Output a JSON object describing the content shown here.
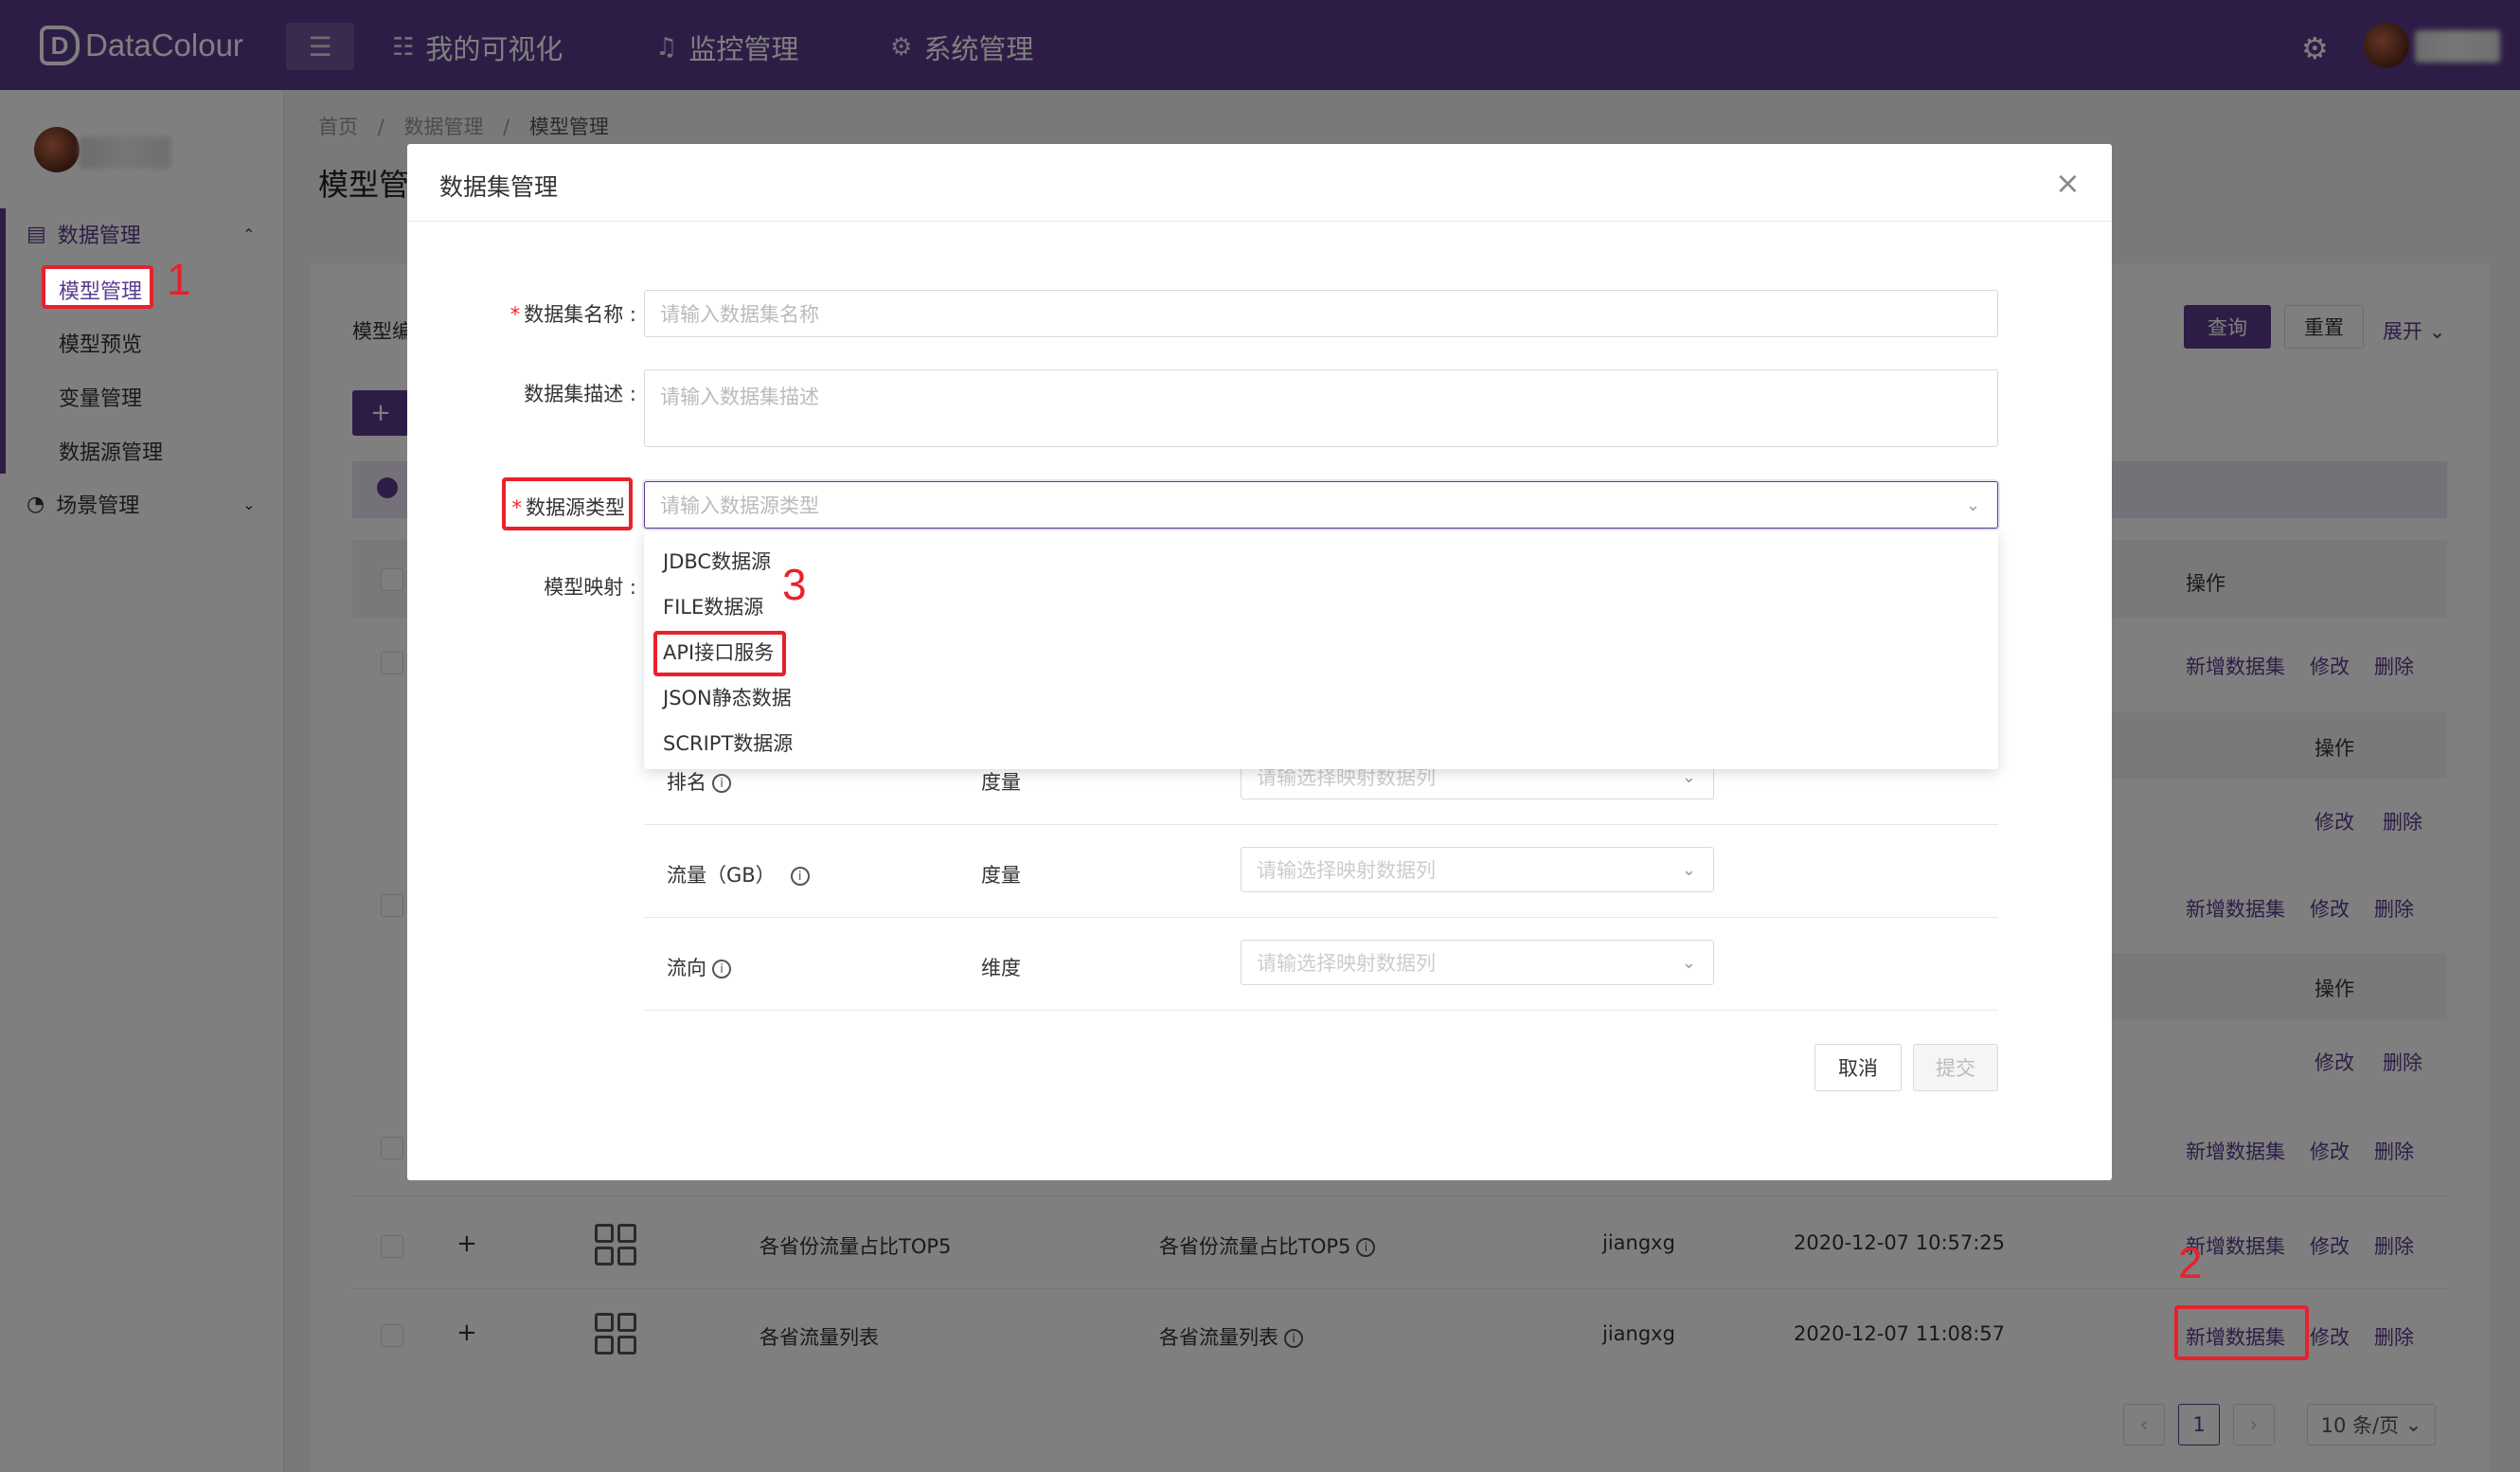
{
  "app": {
    "logo_text": "DataColour"
  },
  "topnav": {
    "items": [
      {
        "label": "我的可视化"
      },
      {
        "label": "监控管理"
      },
      {
        "label": "系统管理"
      }
    ]
  },
  "sidebar": {
    "groups": [
      {
        "label": "数据管理",
        "items": [
          {
            "label": "模型管理"
          },
          {
            "label": "模型预览"
          },
          {
            "label": "变量管理"
          },
          {
            "label": "数据源管理"
          }
        ]
      },
      {
        "label": "场景管理"
      }
    ]
  },
  "breadcrumb": {
    "items": [
      "首页",
      "数据管理",
      "模型管理"
    ],
    "separator": "/"
  },
  "page": {
    "title": "模型管"
  },
  "filter": {
    "label": "模型编",
    "search_label": "查询",
    "reset_label": "重置",
    "expand_label": "展开"
  },
  "table": {
    "header_op": "操作",
    "sub_header_op": "操作",
    "ops": {
      "add_dataset": "新增数据集",
      "edit": "修改",
      "delete": "删除"
    },
    "rows": [
      {
        "name": "各省份流量占比TOP5",
        "alias": "各省份流量占比TOP5",
        "owner": "jiangxg",
        "time": "2020-12-07 10:57:25"
      },
      {
        "name": "各省流量列表",
        "alias": "各省流量列表",
        "owner": "jiangxg",
        "time": "2020-12-07 11:08:57"
      }
    ]
  },
  "pagination": {
    "current": "1",
    "page_size": "10 条/页"
  },
  "dialog": {
    "title": "数据集管理",
    "fields": {
      "name": {
        "label": "数据集名称 :",
        "placeholder": "请输入数据集名称"
      },
      "desc": {
        "label": "数据集描述 :",
        "placeholder": "请输入数据集描述"
      },
      "source_type": {
        "label": "数据源类型",
        "placeholder": "请输入数据源类型"
      },
      "mapping": {
        "label": "模型映射 :"
      }
    },
    "dropdown_options": [
      "JDBC数据源",
      "FILE数据源",
      "API接口服务",
      "JSON静态数据",
      "SCRIPT数据源"
    ],
    "mapping_rows": [
      {
        "field": "排名",
        "type": "度量",
        "placeholder": "请输选择映射数据列"
      },
      {
        "field": "流量（GB）",
        "type": "度量",
        "placeholder": "请输选择映射数据列"
      },
      {
        "field": "流向",
        "type": "维度",
        "placeholder": "请输选择映射数据列"
      }
    ],
    "cancel_label": "取消",
    "submit_label": "提交"
  },
  "annotations": {
    "step1": "1",
    "step2": "2",
    "step3": "3"
  },
  "colors": {
    "brand": "#5b3b8c",
    "annotation": "#e8212b"
  }
}
